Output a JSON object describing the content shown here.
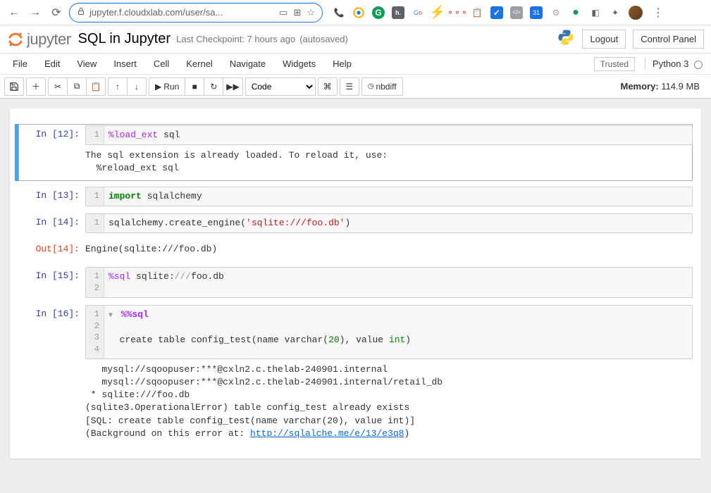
{
  "browser": {
    "url": "jupyter.f.cloudxlab.com/user/sa..."
  },
  "header": {
    "logo_text": "jupyter",
    "title": "SQL in Jupyter",
    "checkpoint": "Last Checkpoint: 7 hours ago",
    "autosave": "(autosaved)",
    "logout": "Logout",
    "control_panel": "Control Panel"
  },
  "menu": {
    "file": "File",
    "edit": "Edit",
    "view": "View",
    "insert": "Insert",
    "cell": "Cell",
    "kernel": "Kernel",
    "navigate": "Navigate",
    "widgets": "Widgets",
    "help": "Help",
    "trusted": "Trusted",
    "kernel_name": "Python 3"
  },
  "toolbar": {
    "run": "Run",
    "cell_type": "Code",
    "nbdiff": "nbdiff",
    "memory_label": "Memory:",
    "memory_value": "114.9 MB"
  },
  "cells": {
    "c12": {
      "prompt": "In [12]:",
      "gutter": "1",
      "code_mag": "%load_ext",
      "code_rest": " sql",
      "out": "The sql extension is already loaded. To reload it, use:\n  %reload_ext sql"
    },
    "c13": {
      "prompt": "In [13]:",
      "gutter": "1",
      "kw": "import",
      "rest": " sqlalchemy"
    },
    "c14": {
      "prompt": "In [14]:",
      "gutter": "1",
      "pre": "sqlalchemy.create_engine(",
      "str": "'sqlite:///foo.db'",
      "post": ")",
      "out_prompt": "Out[14]:",
      "out": "Engine(sqlite:///foo.db)"
    },
    "c15": {
      "prompt": "In [15]:",
      "gutter": "1\n2",
      "mag": "%sql",
      "mid": " sqlite:",
      "slashes": "///",
      "rest": "foo.db"
    },
    "c16": {
      "prompt": "In [16]:",
      "gutter": "1\n2\n3\n4",
      "l1_mag": "%%sql",
      "l3_a": "create table config_test(name varchar(",
      "l3_n1": "20",
      "l3_b": "), value ",
      "l3_kw": "int",
      "l3_c": ")",
      "out_pre": "   mysql://sqoopuser:***@cxln2.c.thelab-240901.internal\n   mysql://sqoopuser:***@cxln2.c.thelab-240901.internal/retail_db\n * sqlite:///foo.db\n(sqlite3.OperationalError) table config_test already exists\n[SQL: create table config_test(name varchar(20), value int)]\n(Background on this error at: ",
      "out_link": "http://sqlalche.me/e/13/e3q8",
      "out_post": ")"
    }
  }
}
